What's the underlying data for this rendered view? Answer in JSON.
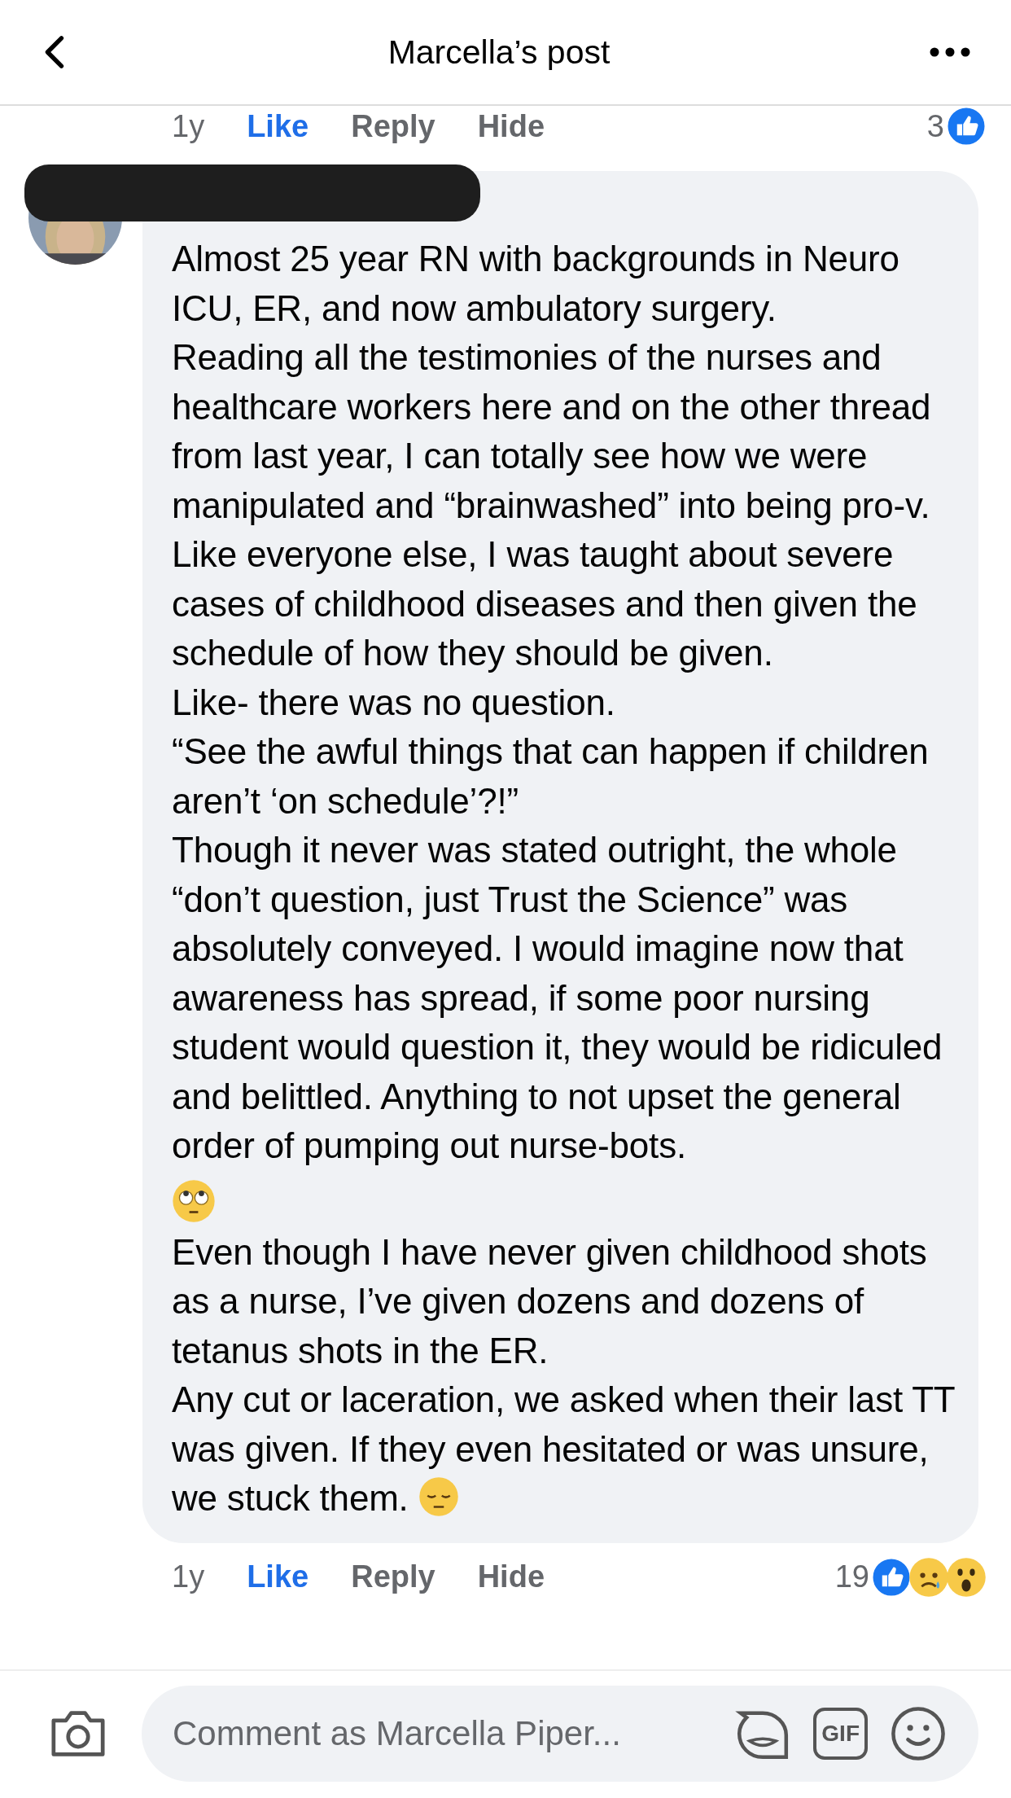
{
  "header": {
    "title": "Marcella’s post"
  },
  "previous_comment_actions": {
    "time": "1y",
    "like": "Like",
    "liked": true,
    "reply": "Reply",
    "hide": "Hide",
    "reaction_count": "3",
    "reactions": [
      {
        "kind": "like"
      }
    ]
  },
  "comment": {
    "paragraphs": [
      {
        "kind": "text",
        "text": "Almost 25 year RN with backgrounds in Neuro ICU, ER, and now ambulatory surgery.",
        "ends_with_emoji": false
      },
      {
        "kind": "text",
        "text": "Reading all the testimonies of the nurses and healthcare workers here and on the other thread from last year, I can totally see how we were manipulated and “brainwashed” into being pro-v.",
        "ends_with_emoji": false
      },
      {
        "kind": "text",
        "text": "Like everyone else, I was taught about severe cases of childhood diseases and then given the schedule of how they should be given.",
        "ends_with_emoji": false
      },
      {
        "kind": "text",
        "text": "Like- there was no question.",
        "ends_with_emoji": false
      },
      {
        "kind": "text",
        "text": "“See the awful things that can happen if children aren’t ‘on schedule’?!”",
        "ends_with_emoji": false
      },
      {
        "kind": "text",
        "text": "Though it never was stated outright, the whole “don’t question, just Trust the Science” was absolutely conveyed. I would imagine now that awareness has spread, if some poor nursing student would question it, they would be ridiculed and belittled. Anything to not upset the general order of pumping out nurse-bots.",
        "ends_with_emoji": false
      },
      {
        "kind": "emoji"
      },
      {
        "kind": "text",
        "text": "Even though I have never given childhood shots as a nurse, I’ve given dozens and dozens of tetanus shots in the ER.",
        "ends_with_emoji": false
      },
      {
        "kind": "text",
        "text": "Any cut or laceration, we asked when their last TT was given. If they even hesitated or was unsure, we stuck them.",
        "ends_with_emoji": true
      }
    ]
  },
  "comment_actions": {
    "time": "1y",
    "like": "Like",
    "liked": true,
    "reply": "Reply",
    "hide": "Hide",
    "reaction_count": "19",
    "reactions": [
      {
        "kind": "like"
      },
      {
        "kind": "sad"
      },
      {
        "kind": "wow"
      }
    ]
  },
  "composer": {
    "placeholder": "Comment as Marcella Piper...",
    "gif_label": "GIF"
  }
}
